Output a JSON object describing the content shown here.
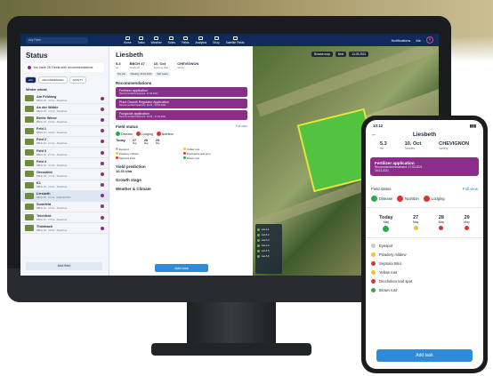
{
  "desktop": {
    "nav": {
      "search_placeholder": "Any Farm",
      "items": [
        "Home",
        "Tasks",
        "Weather",
        "Notes",
        "Fields",
        "Analytics",
        "Shop",
        "Satellite Fields"
      ],
      "right": [
        "Notifications",
        "Me"
      ]
    },
    "sidebar": {
      "title": "Status",
      "banner": "You have 26 Fields with recommendations",
      "chips": [
        "ALL",
        "RECOMMENDED",
        "SAFETY"
      ],
      "group": "Winter wheat",
      "fields": [
        {
          "name": "Am Feldweg",
          "sub": "BBCH 29 · 4.6 ha · Slowshow"
        },
        {
          "name": "An der Wühle",
          "sub": "BBCH 29 · 3.2 ha · Slowshow"
        },
        {
          "name": "Breite Wiese",
          "sub": "BBCH 29 · 5.0 ha · Slowshow"
        },
        {
          "name": "Feld 1",
          "sub": "BBCH 29 · 2.8 ha · Slowshow"
        },
        {
          "name": "Feld 2",
          "sub": "BBCH 29 · 3.1 ha · Slowshow"
        },
        {
          "name": "Feld 3",
          "sub": "BBCH 29 · 2.2 ha · Slowshow"
        },
        {
          "name": "Feld 4",
          "sub": "BBCH 29 · 4.1 ha · Slowshow"
        },
        {
          "name": "Grossfeld",
          "sub": "BBCH 29 · 7.4 ha · Slowshow"
        },
        {
          "name": "K1",
          "sub": "BBCH 29 · 2.0 ha · Slowshow"
        },
        {
          "name": "Liesbeth",
          "sub": "BBCH 29 · 5.3 ha · CHEVIGNON"
        },
        {
          "name": "Sonnfeld",
          "sub": "BBCH 29 · 3.5 ha · Slowshow"
        },
        {
          "name": "Teichfeld",
          "sub": "BBCH 29 · 2.9 ha · Slowshow"
        },
        {
          "name": "Thönbach",
          "sub": "BBCH 29 · 3.8 ha · Slowshow"
        }
      ],
      "add_button": "Add field"
    },
    "detail": {
      "title": "Liesbeth",
      "stats": [
        {
          "value": "5.3",
          "label": "ha"
        },
        {
          "value": "BBCH 47",
          "label": "Seedwell"
        },
        {
          "value": "10. Oct",
          "label": "Seeding date"
        },
        {
          "value": "CHEVIGNON",
          "label": "Variety"
        }
      ],
      "tags": [
        "Dry soil",
        "Planting: 30.10.2020",
        "Soil: Loam"
      ],
      "recommendations_label": "Recommendations",
      "recommendations": [
        {
          "title": "Fertilizer application",
          "sub": "Recommended treatment: 17.03.2021"
        },
        {
          "title": "Plant Growth Regulator Application",
          "sub": "Recommended treatment: 16.03 - 20.03.2021"
        },
        {
          "title": "Fungicide application",
          "sub": "Recommended treatment: 16.03 - 17.03.2021"
        }
      ],
      "field_status_label": "Field status",
      "full_view": "Full view",
      "pills": [
        "Disease",
        "Lodging",
        "Nutrition"
      ],
      "days": [
        {
          "d": "Today",
          "m": ""
        },
        {
          "d": "27",
          "m": "May"
        },
        {
          "d": "28",
          "m": "May"
        },
        {
          "d": "29",
          "m": "May"
        }
      ],
      "legend": [
        "Eyespot",
        "Yellow rust",
        "Powdery mildew",
        "Drechslera leaf spot",
        "Septoria tritici",
        "Brown rust"
      ],
      "yield_label": "Yield prediction",
      "yield_value": "10.31 t/ha",
      "growth_label": "Growth stage",
      "weather_label": "Weather & Climate",
      "add_task": "Add task"
    },
    "map": {
      "date_a": "Browse map",
      "date_b": "Next",
      "date_c": "13.03.2021",
      "layers": [
        "Lat A 1",
        "Lat A 2",
        "Lat A 3",
        "Lat A 4",
        "Lat A 5",
        "Lat A 6"
      ]
    }
  },
  "phone": {
    "time": "10:12",
    "title": "Liesbeth",
    "stats": [
      {
        "value": "5.3",
        "label": "ha"
      },
      {
        "value": "10. Oct",
        "label": "Seeded"
      },
      {
        "value": "CHEVIGNON",
        "label": "Variety"
      }
    ],
    "rec_title": "Fertilizer application",
    "rec_sub": "Recommended treatment: 17.03.2021",
    "rec_sub2": "18.03.2021",
    "field_status": "Field status",
    "full_view": "Full view",
    "pills": [
      "Disease",
      "Nutrition",
      "Lodging"
    ],
    "days": [
      {
        "d": "Today",
        "m": "May"
      },
      {
        "d": "27",
        "m": "May"
      },
      {
        "d": "28",
        "m": "May"
      },
      {
        "d": "29",
        "m": "May"
      }
    ],
    "diseases": [
      "Eyespot",
      "Powdery mildew",
      "Septoria tritici",
      "Yellow rust",
      "Drechslera leaf spot",
      "Brown rust"
    ],
    "add_task": "Add task"
  },
  "colors": {
    "navy": "#0e2b5c",
    "purple": "#8a2d8b",
    "blue": "#2e8bd9",
    "green": "#2ea84a",
    "yellow": "#f2c230",
    "red": "#d9362b"
  }
}
